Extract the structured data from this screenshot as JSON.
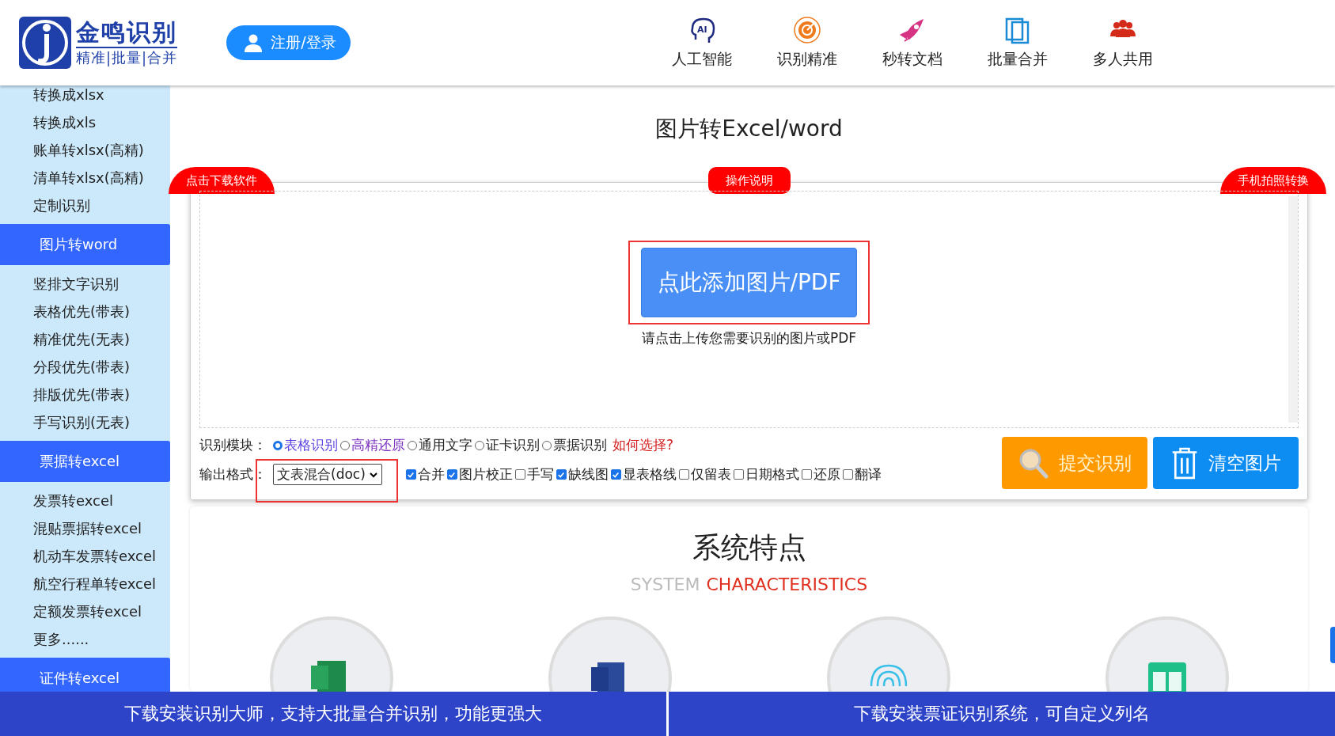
{
  "header": {
    "logo_name": "金鸣识别",
    "logo_slogan": "精准|批量|合并",
    "login_button": "注册/登录",
    "nav": [
      {
        "label": "人工智能",
        "kind": "ai",
        "icon_text": "AI"
      },
      {
        "label": "识别精准",
        "kind": "target"
      },
      {
        "label": "秒转文档",
        "kind": "rocket"
      },
      {
        "label": "批量合并",
        "kind": "pages"
      },
      {
        "label": "多人共用",
        "kind": "people"
      }
    ]
  },
  "sidebar": {
    "items": [
      {
        "label": "转换成xlsx",
        "kind": "link"
      },
      {
        "label": "转换成xls",
        "kind": "link"
      },
      {
        "label": "账单转xlsx(高精)",
        "kind": "link"
      },
      {
        "label": "清单转xlsx(高精)",
        "kind": "link"
      },
      {
        "label": "定制识别",
        "kind": "link"
      },
      {
        "label": "图片转word",
        "kind": "header"
      },
      {
        "label": "竖排文字识别",
        "kind": "link"
      },
      {
        "label": "表格优先(带表)",
        "kind": "link"
      },
      {
        "label": "精准优先(无表)",
        "kind": "link"
      },
      {
        "label": "分段优先(带表)",
        "kind": "link"
      },
      {
        "label": "排版优先(带表)",
        "kind": "link"
      },
      {
        "label": "手写识别(无表)",
        "kind": "link"
      },
      {
        "label": "票据转excel",
        "kind": "header"
      },
      {
        "label": "发票转excel",
        "kind": "link"
      },
      {
        "label": "混贴票据转excel",
        "kind": "link"
      },
      {
        "label": "机动车发票转excel",
        "kind": "link"
      },
      {
        "label": "航空行程单转excel",
        "kind": "link"
      },
      {
        "label": "定额发票转excel",
        "kind": "link"
      },
      {
        "label": "更多......",
        "kind": "link"
      },
      {
        "label": "证件转excel",
        "kind": "header"
      }
    ]
  },
  "main": {
    "title": "图片转Excel/word",
    "tabs": [
      "点击下载软件",
      "操作说明",
      "手机拍照转换"
    ],
    "upload_button": "点此添加图片/PDF",
    "upload_hint": "请点击上传您需要识别的图片或PDF",
    "module_label": "识别模块：",
    "modules": [
      {
        "label": "表格识别",
        "selected": true,
        "color": "#5b3fe0"
      },
      {
        "label": "高精还原",
        "selected": false,
        "color": "#7a2fc0"
      },
      {
        "label": "通用文字",
        "selected": false,
        "color": "#222222"
      },
      {
        "label": "证卡识别",
        "selected": false,
        "color": "#222222"
      },
      {
        "label": "票据识别",
        "selected": false,
        "color": "#222222"
      }
    ],
    "help_link": "如何选择?",
    "format_label": "输出格式：",
    "format_value": "文表混合(doc)",
    "options": [
      {
        "label": "合并",
        "checked": true
      },
      {
        "label": "图片校正",
        "checked": true
      },
      {
        "label": " 手写",
        "checked": false
      },
      {
        "label": "缺线图",
        "checked": true
      },
      {
        "label": "显表格线",
        "checked": true
      },
      {
        "label": "仅留表",
        "checked": false
      },
      {
        "label": "日期格式",
        "checked": false
      },
      {
        "label": "还原",
        "checked": false
      },
      {
        "label": "翻译",
        "checked": false
      }
    ],
    "submit_button": "提交识别",
    "clear_button": "清空图片"
  },
  "features": {
    "title": "系统特点",
    "subtitle_1": "SYSTEM",
    "subtitle_2": "CHARACTERISTICS",
    "circles": [
      {
        "kind": "excel"
      },
      {
        "kind": "word"
      },
      {
        "kind": "fingerprint"
      },
      {
        "kind": "table"
      }
    ]
  },
  "bottom_bar": [
    "下载安装识别大师，支持大批量合并识别，功能更强大",
    "下载安装票证识别系统，可自定义列名"
  ]
}
